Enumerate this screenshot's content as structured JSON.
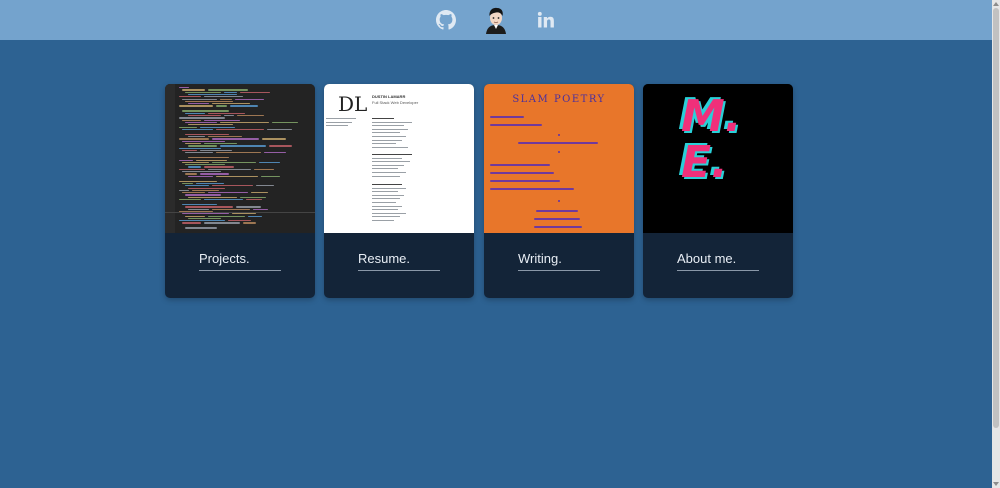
{
  "header": {
    "icons": [
      {
        "name": "github-icon"
      },
      {
        "name": "avatar"
      },
      {
        "name": "linkedin-icon"
      }
    ]
  },
  "cards": [
    {
      "label": "Projects.",
      "thumbnail": "code-editor"
    },
    {
      "label": "Resume.",
      "thumbnail": "resume-document",
      "thumb_text": {
        "initials": "DL",
        "name": "DUSTIN LAMARR",
        "subtitle": "Full Stack Web Developer"
      }
    },
    {
      "label": "Writing.",
      "thumbnail": "slam-poetry",
      "thumb_text": {
        "title": "SLAM POETRY"
      }
    },
    {
      "label": "About me.",
      "thumbnail": "me-logo",
      "thumb_text": {
        "logo": "M.\nE."
      }
    }
  ],
  "colors": {
    "background": "#2d6292",
    "header": "#74a3cd",
    "card": "#132438",
    "writing_thumb": "#e8762a",
    "me_pink": "#f0307a",
    "me_cyan": "#2ad0d8"
  }
}
